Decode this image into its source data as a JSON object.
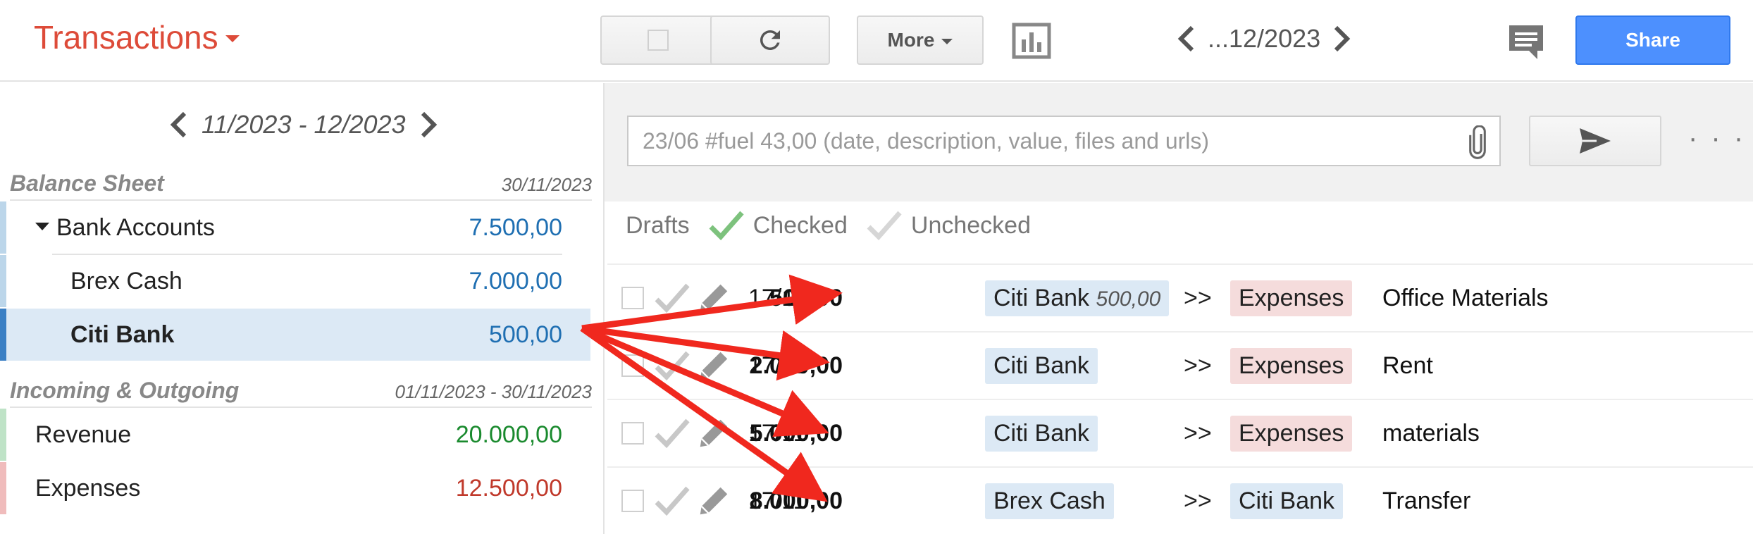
{
  "header": {
    "title": "Transactions",
    "more_label": "More",
    "period_label": "...12/2023",
    "share_label": "Share"
  },
  "left": {
    "period_label": "11/2023 - 12/2023",
    "balance_sheet": {
      "title": "Balance Sheet",
      "date": "30/11/2023",
      "group": {
        "name": "Bank Accounts",
        "value": "7.500,00"
      },
      "accounts": [
        {
          "name": "Brex Cash",
          "value": "7.000,00"
        },
        {
          "name": "Citi Bank",
          "value": "500,00"
        }
      ]
    },
    "income_outgoing": {
      "title": "Incoming & Outgoing",
      "date": "01/11/2023 - 30/11/2023",
      "accounts": [
        {
          "name": "Revenue",
          "value": "20.000,00"
        },
        {
          "name": "Expenses",
          "value": "12.500,00"
        }
      ]
    }
  },
  "composer": {
    "placeholder": "23/06 #fuel 43,00 (date, description, value, files and urls)",
    "more_label": "· · ·"
  },
  "filters": {
    "drafts": "Drafts",
    "checked": "Checked",
    "unchecked": "Unchecked"
  },
  "transactions": [
    {
      "date": "17/11",
      "amount": "500,00",
      "from": "Citi Bank",
      "from_balance": "500,00",
      "arrow": ">>",
      "to": "Expenses",
      "description": "Office Materials"
    },
    {
      "date": "17/11",
      "amount": "2.000,00",
      "from": "Citi Bank",
      "from_balance": "",
      "arrow": ">>",
      "to": "Expenses",
      "description": "Rent"
    },
    {
      "date": "17/11",
      "amount": "5.000,00",
      "from": "Citi Bank",
      "from_balance": "",
      "arrow": ">>",
      "to": "Expenses",
      "description": "materials"
    },
    {
      "date": "17/11",
      "amount": "8.000,00",
      "from": "Brex Cash",
      "from_balance": "",
      "arrow": ">>",
      "to": "Citi Bank",
      "description": "Transfer"
    }
  ],
  "colors": {
    "brand": "#dd4b39",
    "share": "#4d90fe",
    "asset": "#1f6fb2",
    "revenue": "#1a8a2e",
    "expense": "#c0392b",
    "annotation_arrow": "#f0281e"
  }
}
